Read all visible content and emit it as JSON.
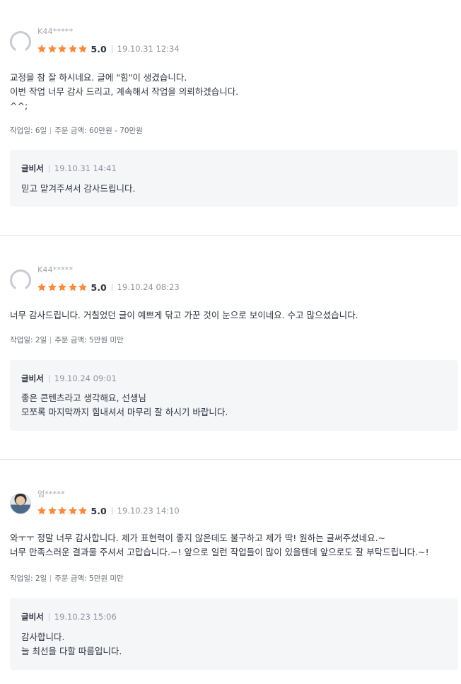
{
  "reviews": [
    {
      "username": "K44*****",
      "avatar": "default-avatar-icon",
      "rating": 5,
      "score": "5.0",
      "date": "19.10.31 12:34",
      "lines": [
        "교정을 참 잘 하시네요. 글에 \"힘\"이 생겼습니다.",
        "이번 작업 너무 감사 드리고, 계속해서 작업을 의뢰하겠습니다.",
        "^^;"
      ],
      "work_days": "작업일: 6일",
      "order_amount": "주문 금액: 60만원 - 70만원",
      "reply": {
        "author": "글비서",
        "date": "19.10.31 14:41",
        "lines": [
          "믿고 맡겨주셔서 감사드립니다."
        ]
      }
    },
    {
      "username": "K44*****",
      "avatar": "default-avatar-icon",
      "rating": 5,
      "score": "5.0",
      "date": "19.10.24 08:23",
      "lines": [
        "너무 감사드립니다. 거칠었던 글이 예쁘게 닦고 가꾼 것이 눈으로 보이네요. 수고 많으셨습니다."
      ],
      "work_days": "작업일: 2일",
      "order_amount": "주문 금액: 5만원 미만",
      "reply": {
        "author": "글비서",
        "date": "19.10.24 09:01",
        "lines": [
          "좋은 콘텐츠라고 생각해요, 선생님",
          "모쪼록 마지막까지 힘내셔서 마무리 잘 하시기 바랍니다."
        ]
      }
    },
    {
      "username": "엄*****",
      "avatar": "user-photo-avatar",
      "rating": 5,
      "score": "5.0",
      "date": "19.10.23 14:10",
      "lines": [
        "와ㅜㅜ 정말 너무 감사합니다. 제가 표현력이 좋지 않은데도 불구하고 제가 딱! 원하는 글써주셨네요.~",
        "너무 만족스러운 결과물 주셔서 고맙습니다.~! 앞으로 일런 작업들이 많이 있을텐데 앞으로도 잘 부탁드립니다.~!"
      ],
      "work_days": "작업일: 2일",
      "order_amount": "주문 금액: 5만원 미만",
      "reply": {
        "author": "글비서",
        "date": "19.10.23 15:06",
        "lines": [
          "감사합니다.",
          "늘 최선을 다할 따름입니다."
        ]
      }
    }
  ],
  "icons": {
    "star": "star-icon"
  },
  "colors": {
    "star": "#fc8a3a",
    "text": "#303441",
    "muted": "#8f939e",
    "reply_bg": "#f5f6f8",
    "divider": "#e4e5ea"
  }
}
